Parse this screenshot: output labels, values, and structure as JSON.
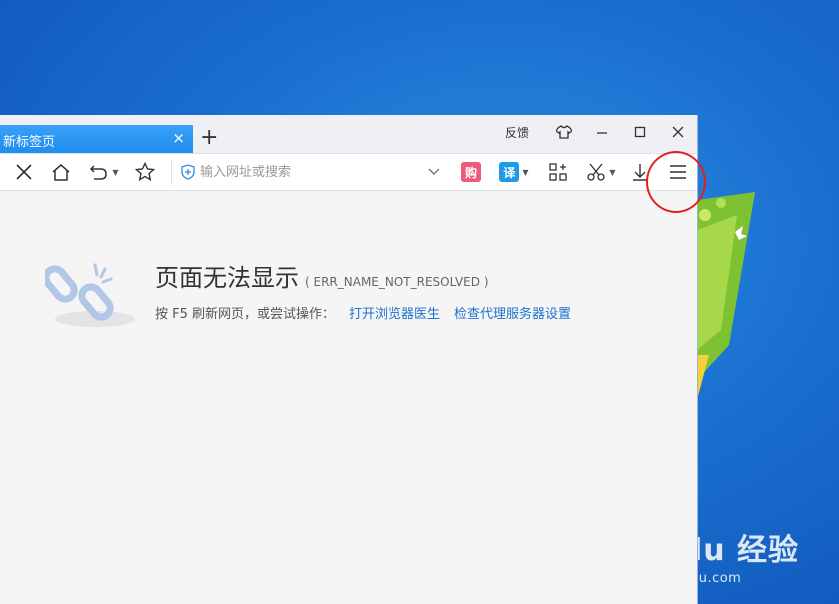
{
  "tab": {
    "title": "新标签页",
    "close": "×"
  },
  "new_tab": "+",
  "window": {
    "feedback": "反馈"
  },
  "toolbar": {
    "address_placeholder": "输入网址或搜索",
    "shop_badge": "购",
    "translate_badge": "译"
  },
  "error": {
    "title": "页面无法显示",
    "code": "( ERR_NAME_NOT_RESOLVED )",
    "hint": "按 F5 刷新网页，或尝试操作：",
    "link_doctor": "打开浏览器医生",
    "link_proxy": "检查代理服务器设置"
  },
  "watermark": {
    "logo": "Bai du 经验",
    "url": "jingyan.baidu.com"
  },
  "colors": {
    "tab": "#1e8ef0",
    "link": "#1a73d0",
    "shop": "#f05a7a",
    "translate": "#1e9be8",
    "annotation": "#e32020"
  }
}
